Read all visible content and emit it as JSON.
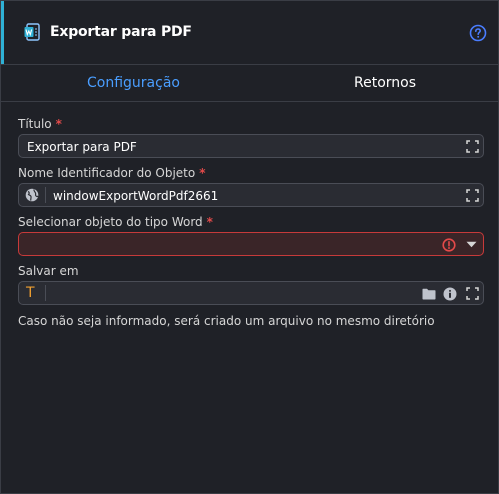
{
  "header": {
    "title": "Exportar para PDF",
    "word_icon": "word-document-icon",
    "help_icon": "help-circle-icon"
  },
  "tabs": [
    {
      "label": "Configuração",
      "active": true
    },
    {
      "label": "Retornos",
      "active": false
    }
  ],
  "form": {
    "titulo": {
      "label": "Título",
      "value": "Exportar para PDF",
      "required": true
    },
    "nome": {
      "label": "Nome Identificador do Objeto",
      "value": "windowExportWordPdf2661",
      "required": true,
      "prefix_icon": "globe-icon"
    },
    "word": {
      "label": "Selecionar objeto do tipo Word",
      "value": "",
      "required": true,
      "state": "error"
    },
    "salvar": {
      "label": "Salvar em",
      "value": "",
      "required": false,
      "prefix_icon": "text-type-icon",
      "prefix_glyph": "T"
    },
    "hint": "Caso não seja informado, será criado um arquivo no mesmo diretório",
    "required_mark": "*"
  },
  "colors": {
    "accent": "#2fb1d6",
    "tab_active": "#4a9eff",
    "error": "#e34a4a",
    "background": "#1f2127"
  }
}
